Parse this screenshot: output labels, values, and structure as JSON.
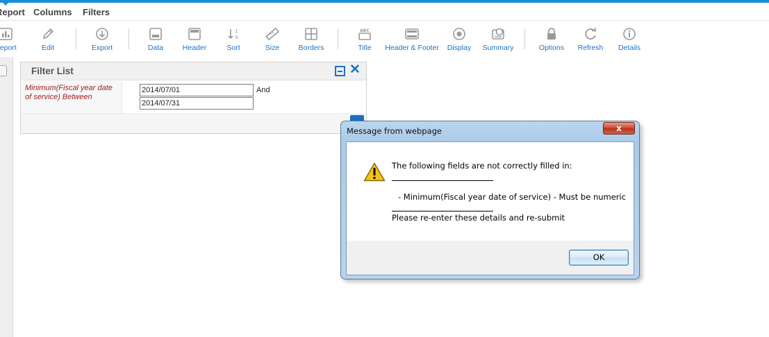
{
  "colors": {
    "accent": "#1a8fd8",
    "link": "#1a73c8",
    "filter_label": "#9b2222"
  },
  "menu": {
    "report": "Report",
    "columns": "Columns",
    "filters": "Filters"
  },
  "toolbar": [
    {
      "label": "Report",
      "icon": "report-icon"
    },
    {
      "label": "Edit",
      "icon": "pencil-icon"
    },
    {
      "label": "Export",
      "icon": "export-icon"
    },
    {
      "label": "Data",
      "icon": "data-icon"
    },
    {
      "label": "Header",
      "icon": "header-icon"
    },
    {
      "label": "Sort",
      "icon": "sort-icon"
    },
    {
      "label": "Size",
      "icon": "ruler-icon"
    },
    {
      "label": "Borders",
      "icon": "borders-icon"
    },
    {
      "label": "Title",
      "icon": "title-icon"
    },
    {
      "label": "Header & Footer",
      "icon": "header-footer-icon"
    },
    {
      "label": "Display",
      "icon": "display-icon"
    },
    {
      "label": "Summary",
      "icon": "summary-icon"
    },
    {
      "label": "Options",
      "icon": "lock-icon"
    },
    {
      "label": "Refresh",
      "icon": "refresh-icon"
    },
    {
      "label": "Details",
      "icon": "info-icon"
    }
  ],
  "filter_panel": {
    "title": "Filter List",
    "label": "Minimum(Fiscal year date of service) Between",
    "value_from": "2014/07/01",
    "value_to": "2014/07/31",
    "connector": "And"
  },
  "dialog": {
    "title": "Message from webpage",
    "line1": "The following fields are not correctly filled in:",
    "line2": "- Minimum(Fiscal year date of service) - Must be numeric",
    "line3": "Please re-enter these details and re-submit",
    "ok_label": "OK",
    "close_glyph": "x"
  }
}
